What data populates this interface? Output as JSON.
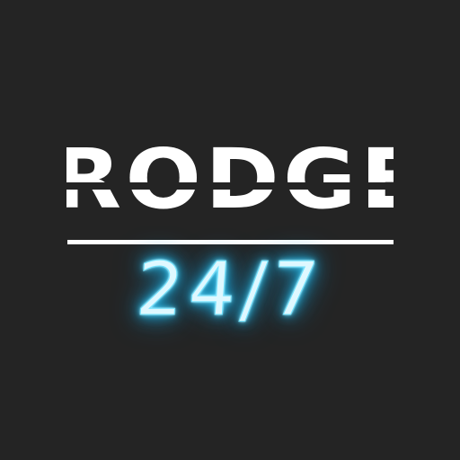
{
  "logo": {
    "brand": "RODGE",
    "tagline": "24/7"
  },
  "colors": {
    "background": "#242424",
    "brand_text": "#ffffff",
    "neon_glow": "#22bff0"
  }
}
